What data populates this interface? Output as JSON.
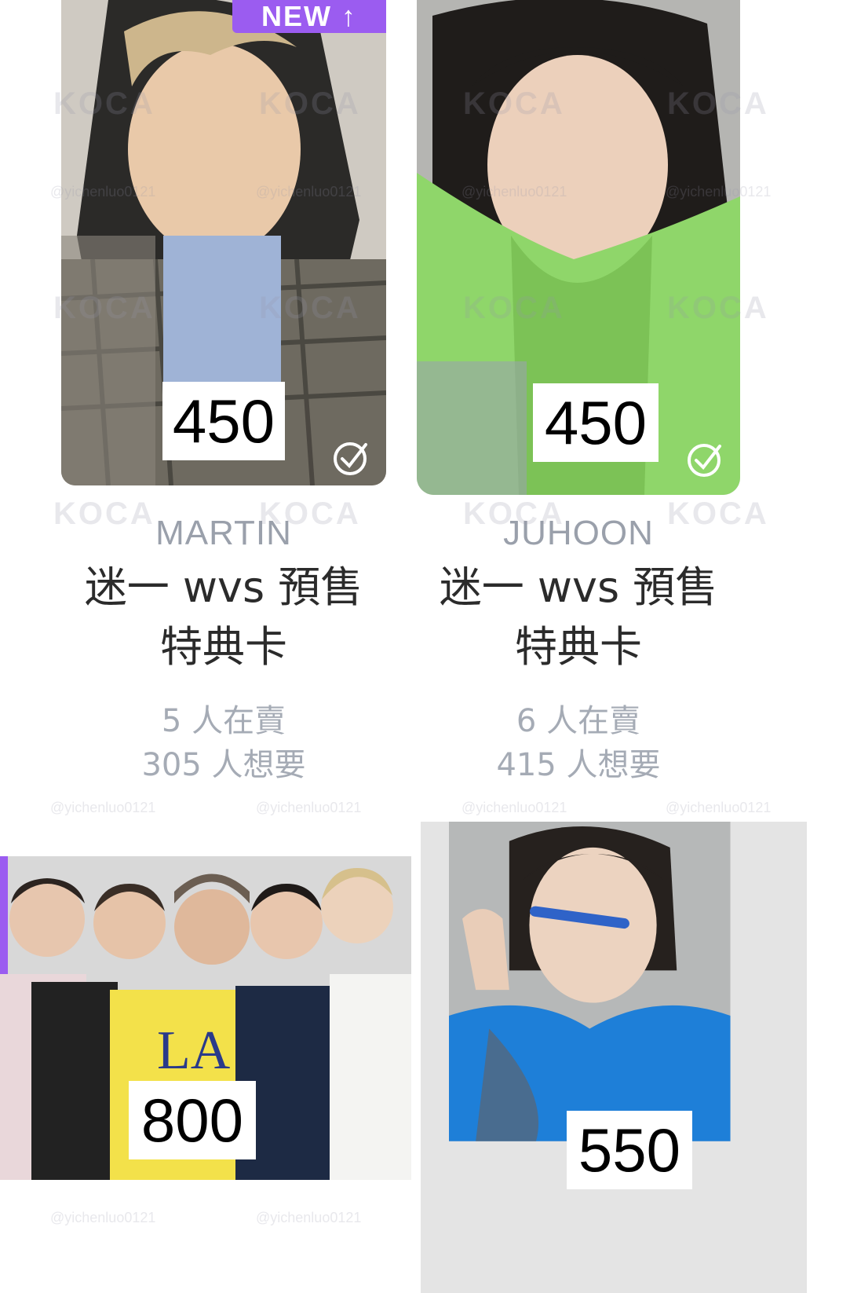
{
  "cards": [
    {
      "badge": "NEW ↑",
      "price": "450",
      "member": "MARTIN",
      "title_line1": "迷一 wvs 預售",
      "title_line2": "特典卡",
      "sellers": "5 人在賣",
      "wanters": "305 人想要"
    },
    {
      "price": "450",
      "member": "JUHOON",
      "title_line1": "迷一 wvs 預售",
      "title_line2": "特典卡",
      "sellers": "6 人在賣",
      "wanters": "415 人想要"
    },
    {
      "price": "800"
    },
    {
      "price": "550"
    }
  ],
  "watermark": {
    "logo": "KOCA",
    "handle": "@yichenluo0121"
  },
  "colors": {
    "badge": "#9b5cf0",
    "member_text": "#9aa0ab",
    "title_text": "#2b2b2b",
    "stats_text": "#a5abb5"
  },
  "icons": [
    "check-circle-icon"
  ]
}
